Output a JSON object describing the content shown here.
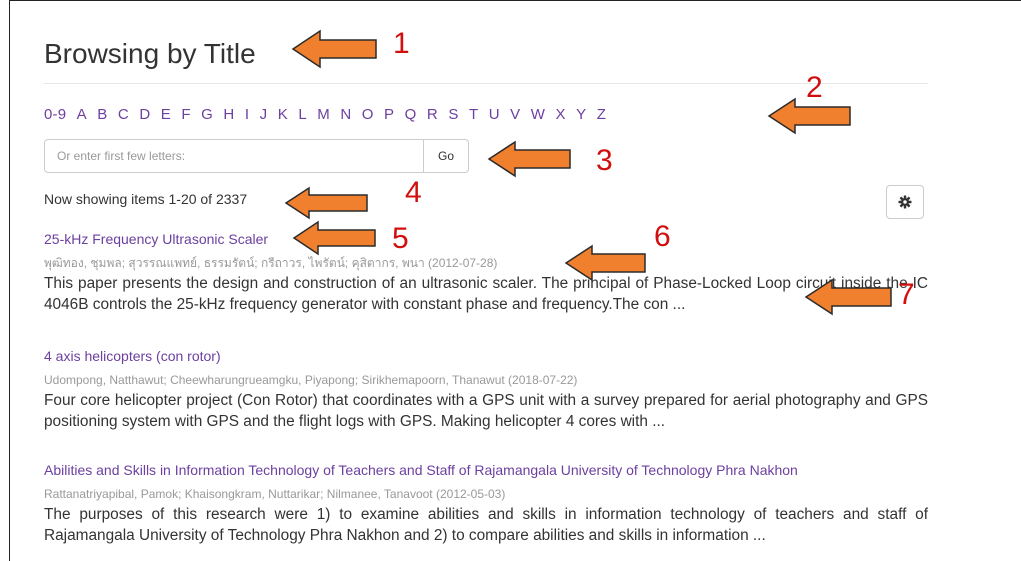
{
  "page": {
    "title": "Browsing by Title"
  },
  "alphabet": [
    "0-9",
    "A",
    "B",
    "C",
    "D",
    "E",
    "F",
    "G",
    "H",
    "I",
    "J",
    "K",
    "L",
    "M",
    "N",
    "O",
    "P",
    "Q",
    "R",
    "S",
    "T",
    "U",
    "V",
    "W",
    "X",
    "Y",
    "Z"
  ],
  "search": {
    "placeholder": "Or enter first few letters:",
    "value": "",
    "go_label": "Go"
  },
  "results": {
    "showing_text": "Now showing items 1-20 of 2337",
    "settings_icon": "gear-icon"
  },
  "items": [
    {
      "title": "25-kHz Frequency Ultrasonic Scaler",
      "meta": "พุฒิทอง, ชุมพล; สุวรรณแพทย์, ธรรมรัตน์; กรีถาวร, ไพรัตน์; คุสิตากร, พนา (2012-07-28)",
      "abstract": "This paper presents the design and construction of an ultrasonic scaler. The principal of Phase-Locked Loop circuit inside the IC 4046B controls the 25-kHz frequency generator with constant phase and frequency.The con ..."
    },
    {
      "title": "4 axis helicopters (con rotor)",
      "meta": "Udompong, Natthawut; Cheewharungrueamgku, Piyapong; Sirikhemapoorn, Thanawut (2018-07-22)",
      "abstract": "Four core helicopter project (Con Rotor) that coordinates with a GPS unit with a survey prepared for aerial photography and GPS positioning system with GPS and the flight logs with GPS. Making helicopter 4 cores with ..."
    },
    {
      "title": "Abilities and Skills in Information Technology of Teachers and Staff of Rajamangala University of Technology Phra Nakhon",
      "meta": "Rattanatriyapibal, Pamok; Khaisongkram, Nuttarikar; Nilmanee, Tanavoot (2012-05-03)",
      "abstract": "The purposes of this research were 1) to examine abilities and skills in information technology of teachers and staff of Rajamangala University of Technology Phra Nakhon and 2) to compare abilities and skills in information ..."
    }
  ],
  "annotations": {
    "numbers": [
      "1",
      "2",
      "3",
      "4",
      "5",
      "6",
      "7"
    ],
    "arrow_color": "#f07f2e",
    "arrow_outline": "#2b2b2b",
    "number_color": "#d10f0f"
  }
}
